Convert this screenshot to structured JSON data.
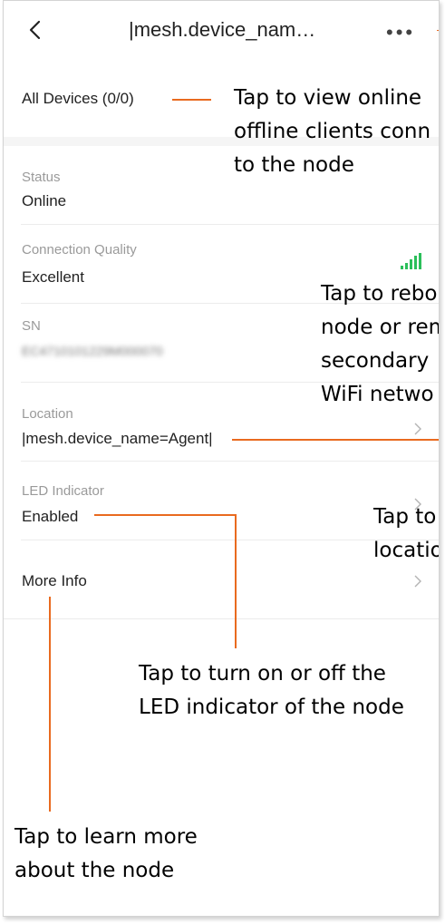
{
  "header": {
    "title": "|mesh.device_nam…",
    "back_icon": "chevron-left-icon",
    "more_icon": "more-dots-icon",
    "more_glyph": "•••"
  },
  "rows": {
    "all_devices": {
      "value": "All Devices (0/0)"
    },
    "status": {
      "label": "Status",
      "value": "Online"
    },
    "connection_quality": {
      "label": "Connection Quality",
      "value": "Excellent",
      "icon": "signal-strength-icon",
      "icon_color": "#2bbf5a"
    },
    "sn": {
      "label": "SN",
      "value": "EC4710101229M000070"
    },
    "location": {
      "label": "Location",
      "value": "|mesh.device_name=Agent|",
      "icon": "chevron-right-icon"
    },
    "led": {
      "label": "LED Indicator",
      "value": "Enabled",
      "icon": "chevron-right-icon"
    },
    "more_info": {
      "value": "More Info",
      "icon": "chevron-right-icon"
    }
  },
  "annotations": {
    "online_offline": [
      "Tap to view online",
      "offline clients conn",
      "to the node"
    ],
    "reboot": [
      "Tap to rebo",
      "node or rem",
      "secondary",
      "WiFi netwo"
    ],
    "location": [
      "Tap to",
      "locatio"
    ],
    "led": [
      "Tap to turn on or off the",
      "LED indicator of the node"
    ],
    "more_info": [
      "Tap to learn more",
      "about the node"
    ]
  },
  "colors": {
    "accent_line": "#e96a1f",
    "label_gray": "#9a9a9a",
    "section_band": "#f5f5f5"
  }
}
